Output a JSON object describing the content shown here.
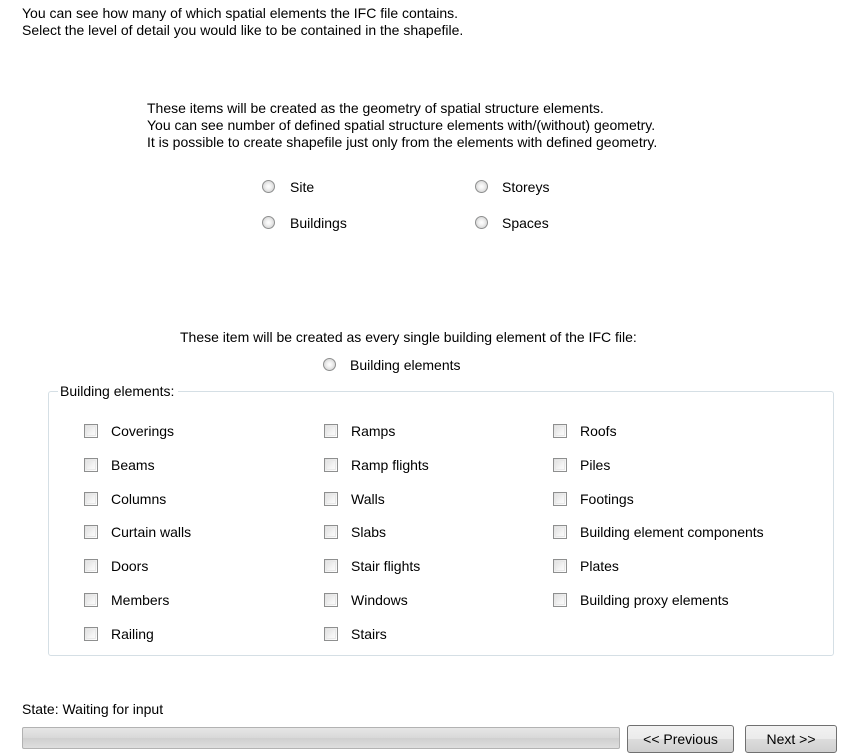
{
  "intro": {
    "line1": "You can see how many of which spatial elements the IFC file contains.",
    "line2": "Select the level of detail you would like to be contained in the shapefile."
  },
  "spatial": {
    "desc1": "These items will be created as the geometry of spatial structure elements.",
    "desc2": "You can see number of defined spatial structure elements with/(without) geometry.",
    "desc3": "It is possible to create shapefile just only from the elements with defined geometry.",
    "options": {
      "site": "Site",
      "buildings": "Buildings",
      "storeys": "Storeys",
      "spaces": "Spaces"
    }
  },
  "building": {
    "desc": "These item will be created as every single building element of the IFC file:",
    "option": "Building elements"
  },
  "group": {
    "title": "Building elements:",
    "col1": [
      "Coverings",
      "Beams",
      "Columns",
      "Curtain walls",
      "Doors",
      "Members",
      "Railing"
    ],
    "col2": [
      "Ramps",
      "Ramp flights",
      "Walls",
      "Slabs",
      "Stair flights",
      "Windows",
      "Stairs"
    ],
    "col3": [
      "Roofs",
      "Piles",
      "Footings",
      "Building element components",
      "Plates",
      "Building proxy elements"
    ]
  },
  "status": {
    "text": "State: Waiting for input",
    "progress": 0
  },
  "buttons": {
    "previous": "<< Previous",
    "next": "Next >>"
  }
}
